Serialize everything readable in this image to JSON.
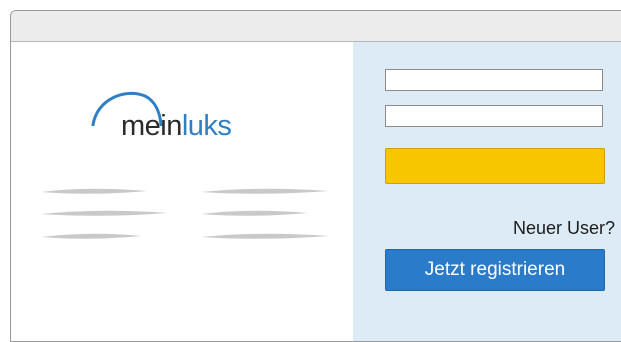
{
  "logo": {
    "text_part1": "mein",
    "text_part2": "luks",
    "dark_color": "#2b2b2b",
    "accent_color": "#2f7fc4"
  },
  "login": {
    "username_value": "",
    "password_value": "",
    "login_button_color": "#f7c600"
  },
  "register": {
    "prompt": "Neuer User?",
    "button_label": "Jetzt registrieren",
    "button_color": "#2a7bca"
  },
  "colors": {
    "panel_background": "#dcebf6",
    "titlebar": "#ececec"
  }
}
